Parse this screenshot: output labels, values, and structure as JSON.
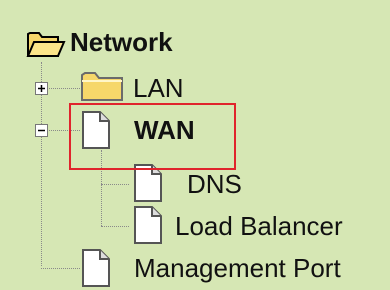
{
  "tree": {
    "root": {
      "label": "Network",
      "icon": "open-folder-icon"
    },
    "nodes": [
      {
        "label": "LAN",
        "icon": "folder-icon",
        "toggle": "+",
        "expanded": false
      },
      {
        "label": "WAN",
        "icon": "document-icon",
        "toggle": "-",
        "expanded": true,
        "selected": true
      },
      {
        "label": "DNS",
        "icon": "document-icon"
      },
      {
        "label": "Load Balancer",
        "icon": "document-icon"
      },
      {
        "label": "Management Port",
        "icon": "document-icon"
      }
    ]
  },
  "colors": {
    "background": "#d6e7b4",
    "highlight_border": "#e0242c",
    "folder_fill": "#f6d76a"
  }
}
